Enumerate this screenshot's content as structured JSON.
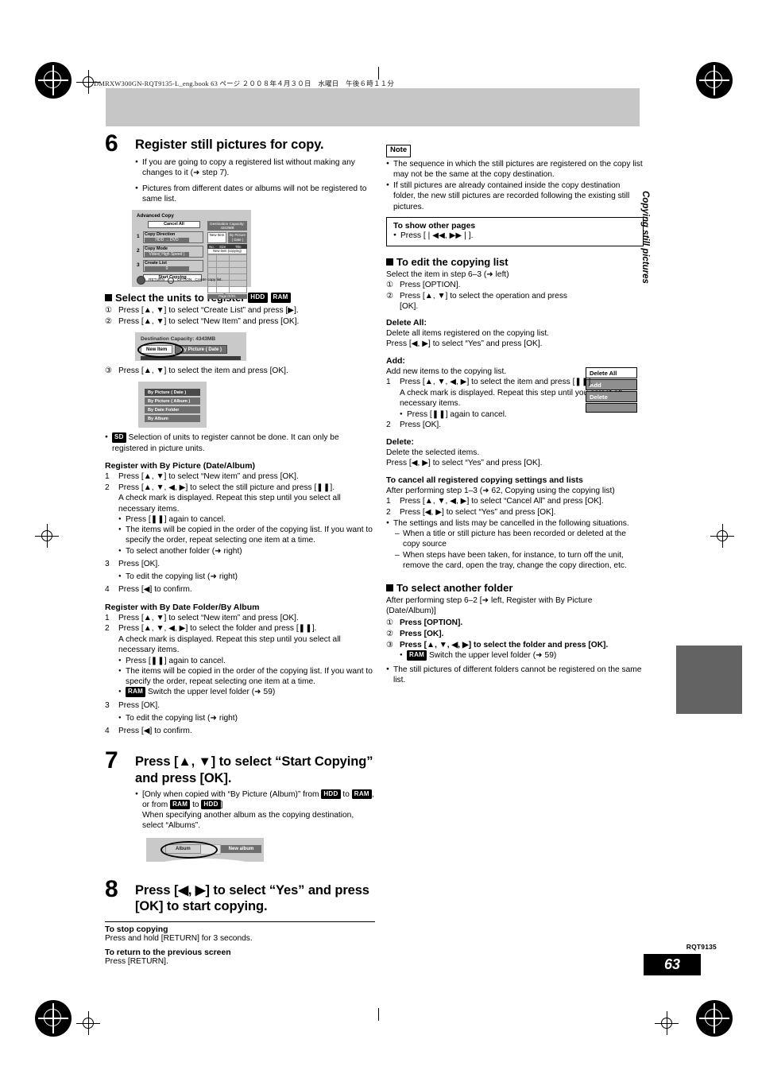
{
  "header": {
    "book_line": "DMRXW300GN-RQT9135-L_eng.book   63 ページ   ２００８年４月３０日　水曜日　午後６時１１分"
  },
  "sidebar": {
    "tab_label": "Copying still pictures"
  },
  "footer": {
    "rqt": "RQT9135",
    "page_number": "63"
  },
  "left": {
    "step6": {
      "num": "6",
      "title": "Register still pictures for copy.",
      "b1": "If you are going to copy a registered list without making any changes to it (➜ step 7).",
      "b2": "Pictures from different dates or albums will not be registered to same list."
    },
    "fig_advanced_copy": {
      "title": "Advanced Copy",
      "cancel_all": "Cancel All",
      "item1_index": "1",
      "item1_label": "Copy Direction",
      "item1_value": "HDD → DVD",
      "item2_index": "2",
      "item2_label": "Copy Mode",
      "item2_value": "Video( High Speed )",
      "item3_index": "3",
      "item3_label": "Create List",
      "item3_value": "0",
      "start_copying": "Start Copying",
      "capacity": "Destination Capacity: 4343MB",
      "tab_new": "New Item",
      "tab_by_picture": "By Picture ( Date )",
      "col_no": "No.",
      "col_size": "Size",
      "col_title": "Title",
      "row_hint": "New item (copying)",
      "page_foot": "Page 01/01",
      "btn_return": "RETURN",
      "btn_option": "OPTION",
      "hint": "Create copy list."
    },
    "select_units": {
      "heading": "Select the units to register",
      "badge_hdd": "HDD",
      "badge_ram": "RAM",
      "s1": "Press [▲, ▼] to select “Create List” and press [▶].",
      "s2": "Press [▲, ▼] to select “New Item” and press [OK].",
      "s3": "Press [▲, ▼] to select the item and press [OK].",
      "n1": "①",
      "n2": "②",
      "n3": "③"
    },
    "fig_destination": {
      "capacity": "Destination Capacity: 4343MB",
      "tab_new_item": "New Item",
      "tab_by_picture": "By Picture ( Date )",
      "col_title": "Title"
    },
    "fig_units_menu": {
      "i1": "By Picture ( Date )",
      "i2": "By Picture ( Album )",
      "i3": "By Date Folder",
      "i4": "By Album"
    },
    "sd_note": {
      "badge_sd": "SD",
      "text": "Selection of units to register cannot be done. It can only be registered in picture units."
    },
    "reg_picture": {
      "heading": "Register with By Picture (Date/Album)",
      "l1n": "1",
      "l1": "Press [▲, ▼] to select “New item” and press [OK].",
      "l2n": "2",
      "l2": "Press [▲, ▼, ◀, ▶] to select the still picture and press [❚❚].",
      "l2c": "A check mark is displayed. Repeat this step until you select all necessary items.",
      "l2b1": "Press [❚❚] again to cancel.",
      "l2b2": "The items will be copied in the order of the copying list. If you want to specify the order, repeat selecting one item at a time.",
      "l2b3": "To select another folder (➜ right)",
      "l3n": "3",
      "l3": "Press [OK].",
      "l3b1": "To edit the copying list (➜ right)",
      "l4n": "4",
      "l4": "Press [◀] to confirm."
    },
    "reg_folder": {
      "heading": "Register with By Date Folder/By Album",
      "l1n": "1",
      "l1": "Press [▲, ▼] to select “New item” and press [OK].",
      "l2n": "2",
      "l2": "Press [▲, ▼, ◀, ▶] to select the folder and press [❚❚].",
      "l2c": "A check mark is displayed. Repeat this step until you select all necessary items.",
      "l2b1": "Press [❚❚] again to cancel.",
      "l2b2": "The items will be copied in the order of the copying list. If you want to specify the order, repeat selecting one item at a time.",
      "l2b3_badge": "RAM",
      "l2b3": "Switch the upper level folder (➜ 59)",
      "l3n": "3",
      "l3": "Press [OK].",
      "l3b1": "To edit the copying list (➜ right)",
      "l4n": "4",
      "l4": "Press [◀] to confirm."
    },
    "step7": {
      "num": "7",
      "title": "Press [▲, ▼] to select “Start Copying” and press [OK].",
      "b1_pre": "[Only when copied with “By Picture (Album)” from",
      "b1_badge1": "HDD",
      "b1_mid1": "to",
      "b1_badge2": "RAM",
      "b1_mid2": ", or from",
      "b1_badge3": "RAM",
      "b1_mid3": "to",
      "b1_badge4": "HDD",
      "b1_tail": "]",
      "b1_rest": "When specifying another album as the copying destination, select “Albums”."
    },
    "fig_album": {
      "album": "Album",
      "new_album": "New album"
    },
    "step8": {
      "num": "8",
      "title": "Press [◀, ▶] to select “Yes” and press [OK] to start copying."
    },
    "stop": {
      "t1": "To stop copying",
      "d1": "Press and hold [RETURN] for 3 seconds.",
      "t2": "To return to the previous screen",
      "d2": "Press [RETURN]."
    }
  },
  "right": {
    "note": {
      "label": "Note",
      "b1": "The sequence in which the still pictures are registered on the copy list may not be the same at the copy destination.",
      "b2": "If still pictures are already contained inside the copy destination folder, the new still pictures are recorded following the existing still pictures."
    },
    "other_pages": {
      "title": "To show other pages",
      "b1": "Press [❘◀◀, ▶▶❘]."
    },
    "edit_list": {
      "heading": "To edit the copying list",
      "intro": "Select the item in step 6–3 (➜ left)",
      "n1": "①",
      "s1": "Press [OPTION].",
      "n2": "②",
      "s2": "Press [▲, ▼] to select the operation and press [OK]."
    },
    "option_menu": {
      "i1": "Delete All",
      "i2": "Add",
      "i3": "Delete"
    },
    "delete_all": {
      "title": "Delete All:",
      "l1": "Delete all items registered on the copying list.",
      "l2": "Press [◀, ▶] to select “Yes” and press [OK]."
    },
    "add": {
      "title": "Add:",
      "l0": "Add new items to the copying list.",
      "l1n": "1",
      "l1": "Press [▲, ▼, ◀, ▶] to select the item and press [❚❚].",
      "l1c": "A check mark is displayed. Repeat this step until you select all necessary items.",
      "l1b": "Press [❚❚] again to cancel.",
      "l2n": "2",
      "l2": "Press [OK]."
    },
    "delete": {
      "title": "Delete:",
      "l1": "Delete the selected items.",
      "l2": "Press [◀, ▶] to select “Yes” and press [OK]."
    },
    "cancel_all": {
      "title": "To cancel all registered copying settings and lists",
      "intro": "After performing step 1–3 (➜ 62, Copying using the copying list)",
      "l1n": "1",
      "l1": "Press [▲, ▼, ◀, ▶] to select “Cancel All” and press [OK].",
      "l2n": "2",
      "l2": "Press [◀, ▶] to select “Yes” and press [OK].",
      "b1": "The settings and lists may be cancelled in the following situations.",
      "d1": "When a title or still picture has been recorded or deleted at the copy source",
      "d2": "When steps have been taken, for instance, to turn off the unit, remove the card, open the tray, change the copy direction, etc."
    },
    "select_folder": {
      "heading": "To select another folder",
      "intro": "After performing step 6–2 [➜ left, Register with By Picture (Date/Album)]",
      "n1": "①",
      "s1": "Press [OPTION].",
      "n2": "②",
      "s2": "Press [OK].",
      "n3": "③",
      "s3": "Press [▲, ▼, ◀, ▶] to select the folder and press [OK].",
      "s3b_badge": "RAM",
      "s3b": "Switch the upper level folder (➜ 59)",
      "b1": "The still pictures of different folders cannot be registered on the same list."
    }
  }
}
